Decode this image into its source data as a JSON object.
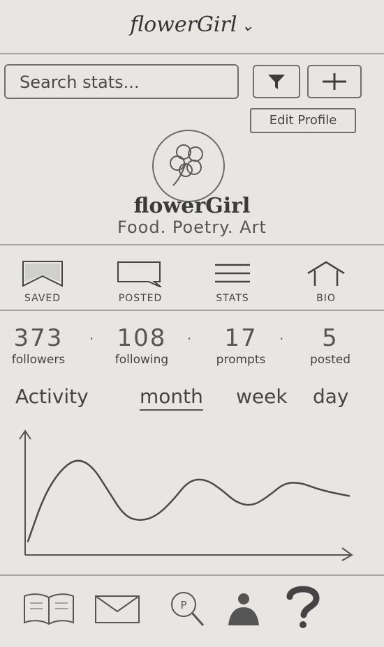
{
  "header": {
    "title": "flowerGirl",
    "dropdown_icon": "chevron-down-icon"
  },
  "search": {
    "placeholder": "Search stats..."
  },
  "toolbar": {
    "filter_icon": "filter-icon",
    "add_icon": "plus-icon",
    "edit_profile_label": "Edit Profile"
  },
  "profile": {
    "name": "flowerGirl",
    "bio": "Food. Poetry. Art",
    "avatar_icon": "flower-icon"
  },
  "nav": [
    {
      "label": "SAVED",
      "icon": "bookmark-icon"
    },
    {
      "label": "POSTED",
      "icon": "speech-bubble-icon"
    },
    {
      "label": "STATS",
      "icon": "lines-icon"
    },
    {
      "label": "BIO",
      "icon": "house-icon"
    }
  ],
  "stats": [
    {
      "value": "373",
      "label": "followers"
    },
    {
      "value": "108",
      "label": "following"
    },
    {
      "value": "17",
      "label": "prompts"
    },
    {
      "value": "5",
      "label": "posted"
    }
  ],
  "activity": {
    "heading": "Activity",
    "tabs": [
      "month",
      "week",
      "day"
    ],
    "active_tab": "month"
  },
  "chart_data": {
    "type": "line",
    "title": "",
    "xlabel": "",
    "ylabel": "",
    "x": [
      0,
      1,
      2,
      3,
      4,
      5,
      6,
      7,
      8,
      9,
      10,
      11,
      12,
      13,
      14,
      15,
      16,
      17,
      18,
      19,
      20
    ],
    "values": [
      0.1,
      0.55,
      0.8,
      0.92,
      0.85,
      0.6,
      0.35,
      0.3,
      0.35,
      0.5,
      0.7,
      0.72,
      0.62,
      0.48,
      0.45,
      0.55,
      0.68,
      0.68,
      0.62,
      0.58,
      0.55
    ],
    "grid": false
  },
  "bottom_nav": [
    {
      "icon": "book-icon"
    },
    {
      "icon": "mail-icon"
    },
    {
      "icon": "search-prompt-icon"
    },
    {
      "icon": "profile-icon"
    },
    {
      "icon": "help-icon"
    }
  ]
}
